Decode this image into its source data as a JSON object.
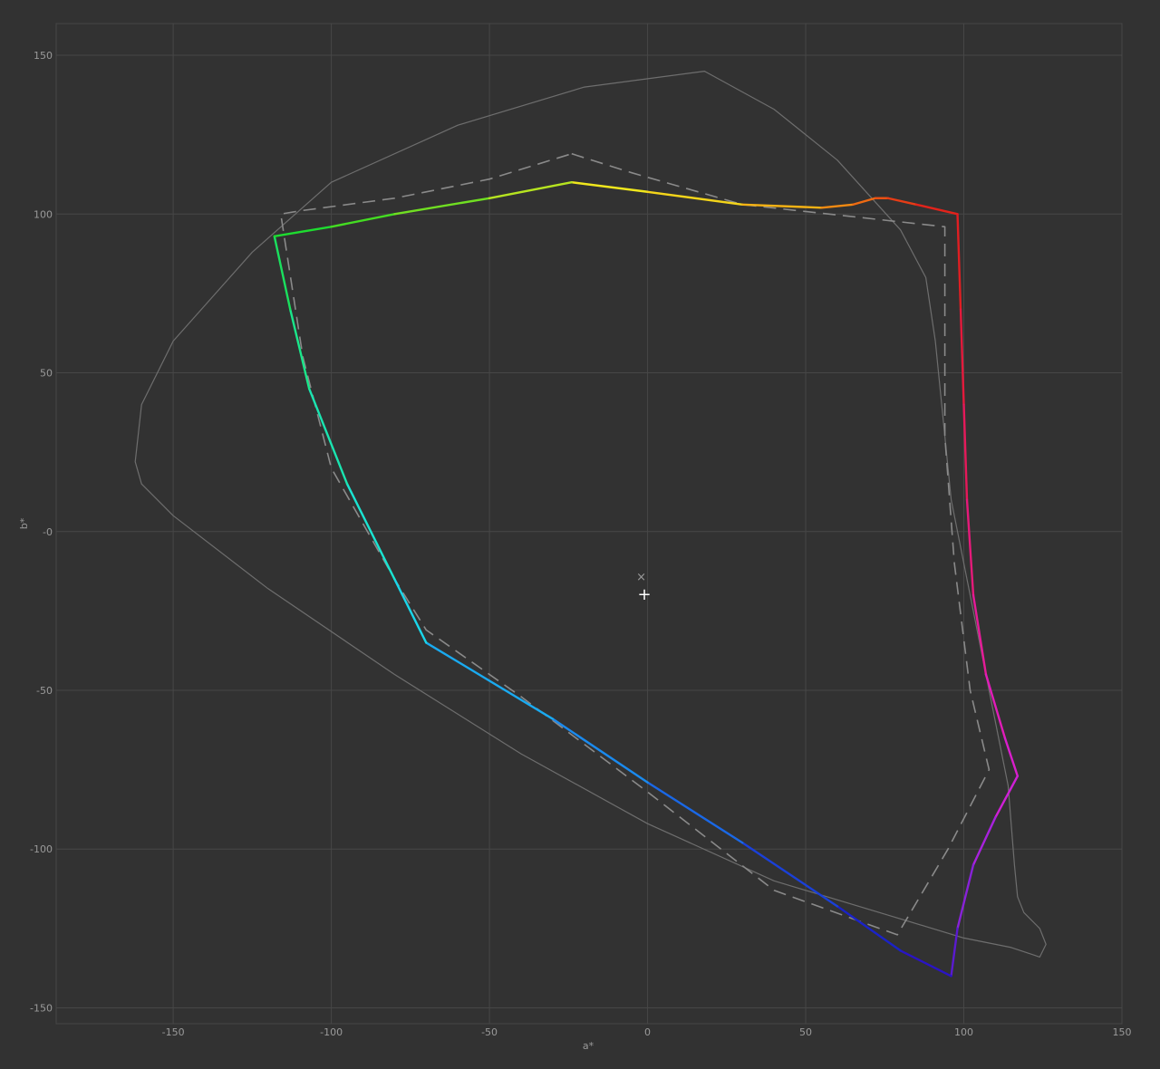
{
  "chart_data": {
    "type": "line",
    "title": "",
    "xlabel": "a*",
    "ylabel": "b*",
    "xlim": [
      -187,
      150
    ],
    "ylim": [
      -155,
      160
    ],
    "xticks": [
      -150,
      -100,
      -50,
      0,
      50,
      100,
      150
    ],
    "xtick_labels": [
      "-150",
      "-100",
      "-50",
      "0",
      "50",
      "100",
      "150"
    ],
    "yticks": [
      150,
      100,
      50,
      0,
      -50,
      -100,
      -150
    ],
    "ytick_labels": [
      "150",
      "100",
      "50",
      "-0",
      "-50",
      "-100",
      "-150"
    ],
    "grid": true,
    "background": "#323232",
    "series": [
      {
        "style": "solid-thin",
        "color": "#6e6e6e",
        "closed": true,
        "points": [
          [
            18,
            145
          ],
          [
            40,
            133
          ],
          [
            60,
            117
          ],
          [
            80,
            95
          ],
          [
            88,
            80
          ],
          [
            91,
            60
          ],
          [
            93,
            40
          ],
          [
            96,
            10
          ],
          [
            102,
            -20
          ],
          [
            108,
            -50
          ],
          [
            114,
            -80
          ],
          [
            116,
            -105
          ],
          [
            117,
            -115
          ],
          [
            119,
            -120
          ],
          [
            124,
            -125
          ],
          [
            126,
            -130
          ],
          [
            124,
            -134
          ],
          [
            115,
            -131
          ],
          [
            100,
            -128
          ],
          [
            80,
            -122
          ],
          [
            40,
            -110
          ],
          [
            0,
            -92
          ],
          [
            -40,
            -70
          ],
          [
            -80,
            -45
          ],
          [
            -120,
            -18
          ],
          [
            -150,
            5
          ],
          [
            -160,
            15
          ],
          [
            -162,
            22
          ],
          [
            -160,
            40
          ],
          [
            -150,
            60
          ],
          [
            -125,
            88
          ],
          [
            -100,
            110
          ],
          [
            -60,
            128
          ],
          [
            -20,
            140
          ]
        ]
      },
      {
        "style": "dashed",
        "color": "#8a8a8a",
        "closed": true,
        "points": [
          [
            -24,
            119
          ],
          [
            -5,
            113
          ],
          [
            30,
            103
          ],
          [
            94,
            96
          ],
          [
            94,
            30
          ],
          [
            97,
            -10
          ],
          [
            102,
            -50
          ],
          [
            108,
            -75
          ],
          [
            95,
            -100
          ],
          [
            79,
            -127
          ],
          [
            40,
            -113
          ],
          [
            0,
            -82
          ],
          [
            -40,
            -52
          ],
          [
            -70,
            -31
          ],
          [
            -80,
            -15
          ],
          [
            -100,
            20
          ],
          [
            -109,
            55
          ],
          [
            -116,
            100
          ],
          [
            -110,
            101
          ],
          [
            -80,
            105
          ],
          [
            -50,
            111
          ]
        ]
      },
      {
        "style": "gradient",
        "closed": true,
        "points": [
          [
            -24,
            110,
            "#f0e71d"
          ],
          [
            0,
            107,
            "#f4d51a"
          ],
          [
            30,
            103,
            "#f5b214"
          ],
          [
            55,
            102,
            "#f28a12"
          ],
          [
            65,
            103,
            "#ee6a12"
          ],
          [
            72,
            105,
            "#ea5013"
          ],
          [
            76,
            105,
            "#e63c16"
          ],
          [
            85,
            103,
            "#e2231b"
          ],
          [
            98,
            100,
            "#e01e22"
          ],
          [
            99,
            70,
            "#e41a3c"
          ],
          [
            100,
            40,
            "#e5195a"
          ],
          [
            101,
            10,
            "#e51a7a"
          ],
          [
            103,
            -20,
            "#e51b98"
          ],
          [
            107,
            -45,
            "#e11cb8"
          ],
          [
            113,
            -65,
            "#da1ecc"
          ],
          [
            117,
            -77,
            "#cf20d6"
          ],
          [
            110,
            -90,
            "#a822dd"
          ],
          [
            103,
            -105,
            "#8822d8"
          ],
          [
            98,
            -125,
            "#5a1ad0"
          ],
          [
            96,
            -140,
            "#2a14c4"
          ],
          [
            80,
            -132,
            "#1a22c8"
          ],
          [
            60,
            -118,
            "#1a40d8"
          ],
          [
            30,
            -98,
            "#1a68e6"
          ],
          [
            0,
            -79,
            "#1a8aee"
          ],
          [
            -30,
            -59,
            "#1aaaf0"
          ],
          [
            -70,
            -35,
            "#1ad6ea"
          ],
          [
            -80,
            -15,
            "#1ae4d2"
          ],
          [
            -95,
            15,
            "#1ae4b0"
          ],
          [
            -107,
            45,
            "#1ae68a"
          ],
          [
            -113,
            70,
            "#1ae05e"
          ],
          [
            -118,
            93,
            "#1edc30"
          ],
          [
            -100,
            96,
            "#44dc22"
          ],
          [
            -80,
            100,
            "#70df22"
          ],
          [
            -50,
            105,
            "#b6e420"
          ]
        ]
      }
    ],
    "markers": [
      {
        "symbol": "×",
        "x": -2,
        "y": -14,
        "color": "#9a9a9a"
      },
      {
        "symbol": "+",
        "x": -1,
        "y": -20,
        "color": "#ffffff"
      }
    ]
  }
}
